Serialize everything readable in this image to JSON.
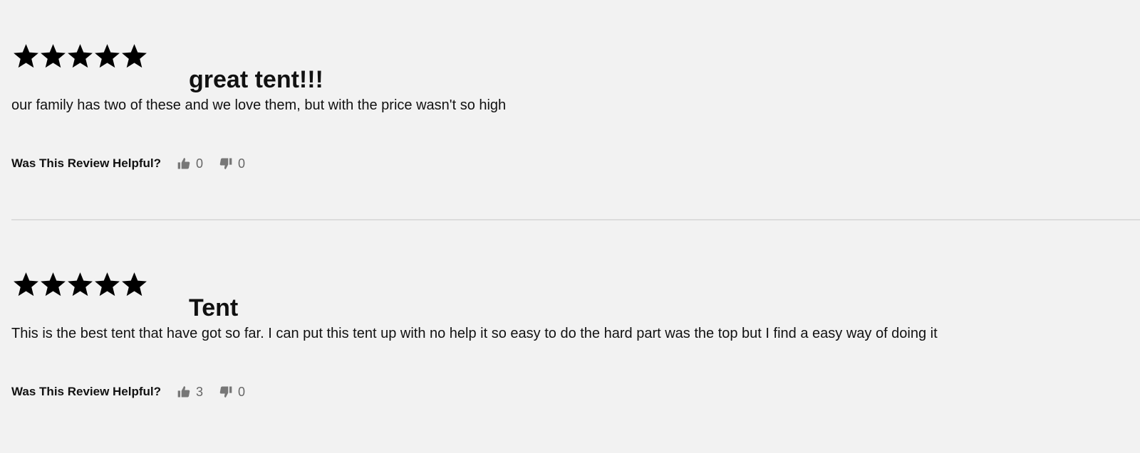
{
  "helpful_label": "Was This Review Helpful?",
  "colors": {
    "background": "#f2f2f2",
    "star": "#000000",
    "vote_icon": "#777777",
    "divider": "#dcdcdc"
  },
  "reviews": [
    {
      "rating": 5,
      "rating_max": 5,
      "title": "great tent!!!",
      "body": "our family has two of these and we love them, but with the price wasn't so high",
      "helpful_up": "0",
      "helpful_down": "0",
      "icons": {
        "star": "star-icon",
        "up": "thumbs-up-icon",
        "down": "thumbs-down-icon"
      }
    },
    {
      "rating": 5,
      "rating_max": 5,
      "title": "Tent",
      "body": "This is the best tent that have got so far. I can put this tent up with no help it so easy to do the hard part was the top but I find a easy way of doing it",
      "helpful_up": "3",
      "helpful_down": "0",
      "icons": {
        "star": "star-icon",
        "up": "thumbs-up-icon",
        "down": "thumbs-down-icon"
      }
    }
  ]
}
